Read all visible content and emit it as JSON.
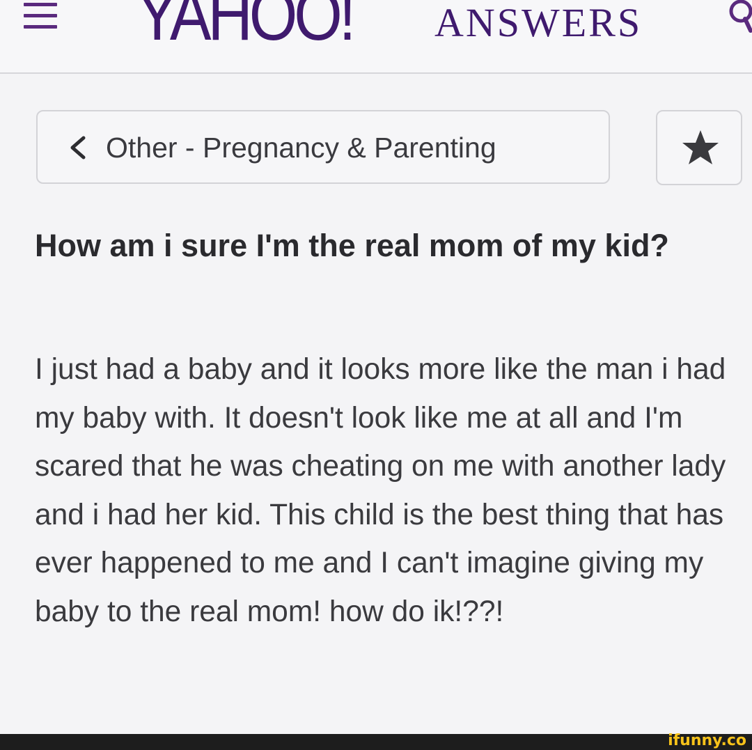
{
  "header": {
    "logo_main": "YAHOO!",
    "logo_sub": "ANSWERS"
  },
  "category": {
    "label": "Other - Pregnancy & Parenting"
  },
  "question": {
    "title": "How am i sure I'm the real mom of my kid?",
    "body": "I just had a baby and it looks more like the man i had my baby with.  It doesn't look like me at all and I'm scared that he was cheating on me with another lady and i had her kid.  This child is the best thing that has ever happened to me and I can't imagine giving my baby to the real mom! how do ik!??!"
  },
  "watermark": "ifunny.co",
  "colors": {
    "brand_purple": "#3f1a6e",
    "text": "#2a2a2e",
    "watermark_yellow": "#f6c21a"
  },
  "icons": {
    "menu": "hamburger-icon",
    "search": "search-icon",
    "back": "chevron-left-icon",
    "favorite": "star-icon"
  }
}
